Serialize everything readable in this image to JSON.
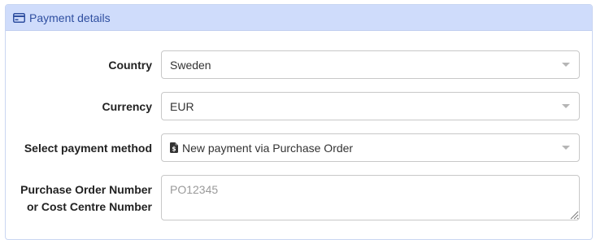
{
  "panel": {
    "title": "Payment details",
    "icon": "credit-card-icon",
    "accent_color": "#2f4fa0",
    "heading_bg": "#cfdcfb"
  },
  "form": {
    "country": {
      "label": "Country",
      "value": "Sweden"
    },
    "currency": {
      "label": "Currency",
      "value": "EUR"
    },
    "payment_method": {
      "label": "Select payment method",
      "value": "New payment via Purchase Order",
      "icon": "invoice-dollar-icon"
    },
    "po_number": {
      "label_line1": "Purchase Order Number",
      "label_line2": "or Cost Centre Number",
      "placeholder": "PO12345",
      "value": ""
    }
  }
}
